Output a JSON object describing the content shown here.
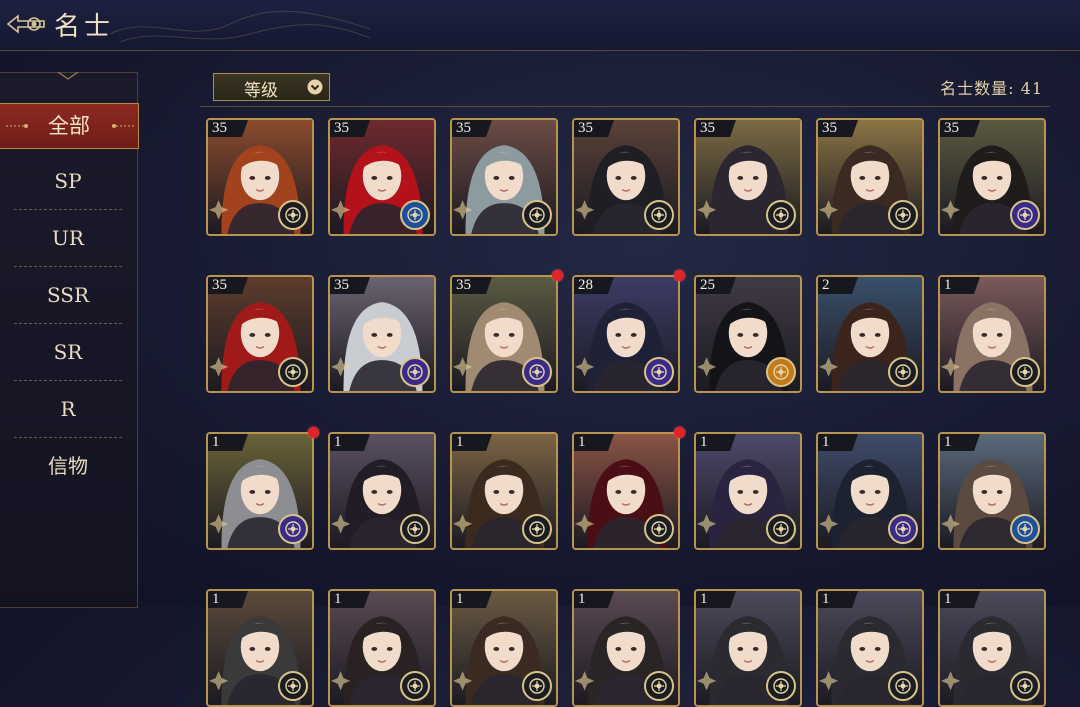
{
  "header": {
    "title": "名士"
  },
  "sidebar": {
    "items": [
      {
        "label": "全部",
        "active": true
      },
      {
        "label": "SP"
      },
      {
        "label": "UR"
      },
      {
        "label": "SSR"
      },
      {
        "label": "SR"
      },
      {
        "label": "R"
      },
      {
        "label": "信物"
      }
    ]
  },
  "filter": {
    "label": "等级"
  },
  "count": {
    "text": "名士数量: 41"
  },
  "colors": {
    "accent_gold": "#b8944f",
    "active_red": "#8d2a22",
    "notif": "#e1242a"
  },
  "cards": [
    {
      "level": "35",
      "hair": "#a2431e",
      "bg": "#8a4b2d",
      "faction": "dark",
      "notif": false
    },
    {
      "level": "35",
      "hair": "#b3121b",
      "bg": "#6e2a2e",
      "faction": "blue",
      "notif": false
    },
    {
      "level": "35",
      "hair": "#8d9aa0",
      "bg": "#6c4c45",
      "faction": "dark",
      "notif": false
    },
    {
      "level": "35",
      "hair": "#1e1e24",
      "bg": "#5a4238",
      "faction": "dark",
      "notif": false
    },
    {
      "level": "35",
      "hair": "#2b2630",
      "bg": "#7a6a42",
      "faction": "dark",
      "notif": false
    },
    {
      "level": "35",
      "hair": "#3a2a22",
      "bg": "#8a7444",
      "faction": "dark",
      "notif": false
    },
    {
      "level": "35",
      "hair": "#1f1b1b",
      "bg": "#5a5a40",
      "faction": "purple",
      "notif": false
    },
    {
      "level": "35",
      "hair": "#a11a1a",
      "bg": "#5c3c2c",
      "faction": "dark",
      "notif": false
    },
    {
      "level": "35",
      "hair": "#c9cdd2",
      "bg": "#6a6270",
      "faction": "purple",
      "notif": false
    },
    {
      "level": "35",
      "hair": "#a08b72",
      "bg": "#5a5a42",
      "faction": "purple",
      "notif": true
    },
    {
      "level": "28",
      "hair": "#1f2236",
      "bg": "#3c3c66",
      "faction": "purple",
      "notif": true
    },
    {
      "level": "25",
      "hair": "#141418",
      "bg": "#403a44",
      "faction": "orange",
      "notif": false
    },
    {
      "level": "2",
      "hair": "#3b241c",
      "bg": "#39506a",
      "faction": "dark",
      "notif": false
    },
    {
      "level": "1",
      "hair": "#8a7264",
      "bg": "#7a5a5a",
      "faction": "dark",
      "notif": false
    },
    {
      "level": "1",
      "hair": "#8c8e92",
      "bg": "#6a6238",
      "faction": "purple",
      "notif": true
    },
    {
      "level": "1",
      "hair": "#221c26",
      "bg": "#5a5062",
      "faction": "dark",
      "notif": false
    },
    {
      "level": "1",
      "hair": "#3b2a1e",
      "bg": "#7a6444",
      "faction": "dark",
      "notif": false
    },
    {
      "level": "1",
      "hair": "#4a0f14",
      "bg": "#8a5444",
      "faction": "dark",
      "notif": true
    },
    {
      "level": "1",
      "hair": "#2a2440",
      "bg": "#4c4a68",
      "faction": "dark",
      "notif": false
    },
    {
      "level": "1",
      "hair": "#1d2230",
      "bg": "#3e4c6a",
      "faction": "purple",
      "notif": false
    },
    {
      "level": "1",
      "hair": "#5a4a40",
      "bg": "#5a6a7a",
      "faction": "blue",
      "notif": false
    },
    {
      "level": "1",
      "hair": "#3a3a3a",
      "bg": "#5a4a3a",
      "faction": "dark",
      "notif": false
    },
    {
      "level": "1",
      "hair": "#2a2222",
      "bg": "#5a4a52",
      "faction": "dark",
      "notif": false
    },
    {
      "level": "1",
      "hair": "#3a2a22",
      "bg": "#6a5a42",
      "faction": "dark",
      "notif": false
    },
    {
      "level": "1",
      "hair": "#2a2424",
      "bg": "#5a4a52",
      "faction": "dark",
      "notif": false
    },
    {
      "level": "1",
      "hair": "#2a2a30",
      "bg": "#4a4a5a",
      "faction": "dark",
      "notif": false
    },
    {
      "level": "1",
      "hair": "#2a2a30",
      "bg": "#4a4a5a",
      "faction": "dark",
      "notif": false
    },
    {
      "level": "1",
      "hair": "#2a2a30",
      "bg": "#4a4a5a",
      "faction": "dark",
      "notif": false
    }
  ]
}
